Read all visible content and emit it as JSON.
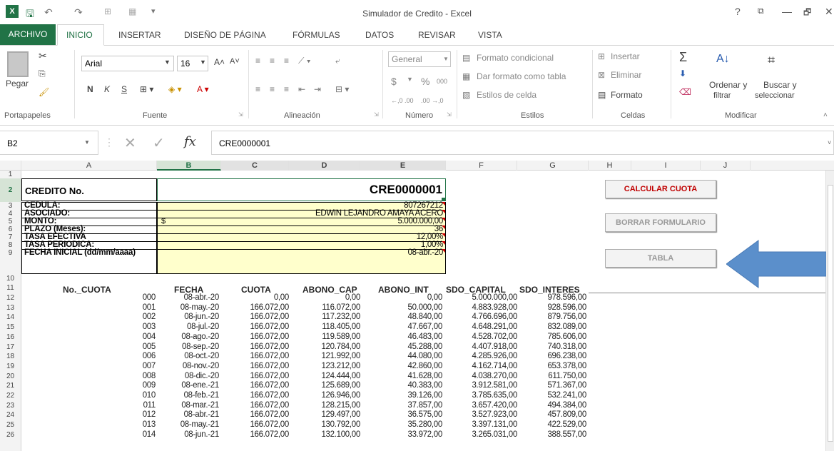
{
  "window": {
    "title": "Simulador de Credito - Excel",
    "help": "?",
    "restore": "⧉",
    "min": "—",
    "max": "🗗",
    "close": "✕"
  },
  "tabs": [
    "ARCHIVO",
    "INICIO",
    "INSERTAR",
    "DISEÑO DE PÁGINA",
    "FÓRMULAS",
    "DATOS",
    "REVISAR",
    "VISTA"
  ],
  "ribbon": {
    "paste": "Pegar",
    "font_name": "Arial",
    "font_size": "16",
    "bold": "N",
    "italic": "K",
    "underline": "S",
    "number_format": "General",
    "currency": "$",
    "percent": "%",
    "thousands": "000",
    "dec_inc": "←,0 .00",
    "dec_dec": ".00 →,0",
    "cond_format": "Formato condicional",
    "as_table": "Dar formato como tabla",
    "cell_styles": "Estilos de celda",
    "insert": "Insertar",
    "delete": "Eliminar",
    "format": "Formato",
    "sort_filter_1": "Ordenar y",
    "sort_filter_2": "filtrar",
    "find_1": "Buscar y",
    "find_2": "seleccionar",
    "groups": [
      "Portapapeles",
      "Fuente",
      "Alineación",
      "Número",
      "Estilos",
      "Celdas",
      "Modificar"
    ]
  },
  "formula": {
    "namebox": "B2",
    "fx": "fx",
    "value": "CRE0000001"
  },
  "columns": [
    "A",
    "B",
    "C",
    "D",
    "E",
    "F",
    "G",
    "H",
    "I",
    "J"
  ],
  "form": {
    "credito_label": "CREDITO No.",
    "credito_value": "CRE0000001",
    "cedula_label": "CEDULA:",
    "cedula_value": "807267212",
    "asociado_label": "ASOCIADO:",
    "asociado_value": "EDWIN LEJANDRO AMAYA ACERO",
    "monto_label": "MONTO:",
    "monto_currency": "$",
    "monto_value": "5.000.000,00",
    "plazo_label": "PLAZO (Meses):",
    "plazo_value": "36",
    "tasa_ef_label": "TASA EFECTIVA",
    "tasa_ef_value": "12,00%",
    "tasa_per_label": "TASA PERIODICA:",
    "tasa_per_value": "1,00%",
    "fecha_label": "FECHA INICIAL (dd/mm/aaaa)",
    "fecha_value": "08-abr.-20"
  },
  "buttons": {
    "calcular": "CALCULAR CUOTA",
    "borrar": "BORRAR FORMULARIO",
    "tabla": "TABLA"
  },
  "table": {
    "headers": [
      "No._CUOTA",
      "FECHA",
      "CUOTA",
      "ABONO_CAP",
      "ABONO_INT",
      "SDO_CAPITAL",
      "SDO_INTERES"
    ],
    "rows": [
      [
        "000",
        "08-abr.-20",
        "0,00",
        "0,00",
        "0,00",
        "5.000.000,00",
        "978.596,00"
      ],
      [
        "001",
        "08-may.-20",
        "166.072,00",
        "116.072,00",
        "50.000,00",
        "4.883.928,00",
        "928.596,00"
      ],
      [
        "002",
        "08-jun.-20",
        "166.072,00",
        "117.232,00",
        "48.840,00",
        "4.766.696,00",
        "879.756,00"
      ],
      [
        "003",
        "08-jul.-20",
        "166.072,00",
        "118.405,00",
        "47.667,00",
        "4.648.291,00",
        "832.089,00"
      ],
      [
        "004",
        "08-ago.-20",
        "166.072,00",
        "119.589,00",
        "46.483,00",
        "4.528.702,00",
        "785.606,00"
      ],
      [
        "005",
        "08-sep.-20",
        "166.072,00",
        "120.784,00",
        "45.288,00",
        "4.407.918,00",
        "740.318,00"
      ],
      [
        "006",
        "08-oct.-20",
        "166.072,00",
        "121.992,00",
        "44.080,00",
        "4.285.926,00",
        "696.238,00"
      ],
      [
        "007",
        "08-nov.-20",
        "166.072,00",
        "123.212,00",
        "42.860,00",
        "4.162.714,00",
        "653.378,00"
      ],
      [
        "008",
        "08-dic.-20",
        "166.072,00",
        "124.444,00",
        "41.628,00",
        "4.038.270,00",
        "611.750,00"
      ],
      [
        "009",
        "08-ene.-21",
        "166.072,00",
        "125.689,00",
        "40.383,00",
        "3.912.581,00",
        "571.367,00"
      ],
      [
        "010",
        "08-feb.-21",
        "166.072,00",
        "126.946,00",
        "39.126,00",
        "3.785.635,00",
        "532.241,00"
      ],
      [
        "011",
        "08-mar.-21",
        "166.072,00",
        "128.215,00",
        "37.857,00",
        "3.657.420,00",
        "494.384,00"
      ],
      [
        "012",
        "08-abr.-21",
        "166.072,00",
        "129.497,00",
        "36.575,00",
        "3.527.923,00",
        "457.809,00"
      ],
      [
        "013",
        "08-may.-21",
        "166.072,00",
        "130.792,00",
        "35.280,00",
        "3.397.131,00",
        "422.529,00"
      ],
      [
        "014",
        "08-jun.-21",
        "166.072,00",
        "132.100,00",
        "33.972,00",
        "3.265.031,00",
        "388.557,00"
      ]
    ]
  },
  "colors": {
    "excel_green": "#217346",
    "arrow_blue": "#5b8fcb",
    "cell_yellow": "#ffffcc"
  }
}
